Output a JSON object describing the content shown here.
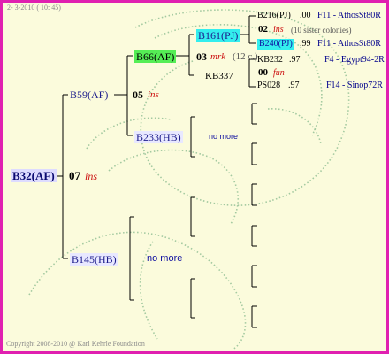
{
  "header": {
    "date": "2-  3-2010 ( 10: 45)"
  },
  "footer": {
    "copyright": "Copyright 2008-2010 @ Karl Kehrle Foundation"
  },
  "colors": {
    "border": "#e020b0",
    "background": "#fbfbdc",
    "line": "#000000",
    "root_box": "#dddbff",
    "pale_box": "#e8e8ff",
    "green_box": "#55ee55",
    "cyan_box": "#33eeee",
    "watermark": "#9ac49a"
  },
  "pedigree": {
    "root": {
      "label": "B32(AF)",
      "num": "07",
      "tag": "ins"
    },
    "sire": {
      "label": "B59(AF)",
      "num": "05",
      "tag": "ins"
    },
    "dam": {
      "label": "B145(HB)",
      "note": "no more"
    },
    "sire_sire": {
      "label": "B66(AF)",
      "num": "03",
      "tag": "mrk",
      "extra": "(12 c.)"
    },
    "sire_dam": {
      "label": "B233(HB)",
      "note": "no more"
    },
    "sss": {
      "label": "B161(PJ)"
    },
    "ssd": {
      "label": "KB337"
    },
    "g4": [
      {
        "label": "B216(PJ)",
        "value": ".00",
        "info": "F11 - AthosSt80R"
      },
      {
        "num": "02",
        "tag": "ins",
        "extra": "(10 sister colonies)"
      },
      {
        "label": "B240(PJ)",
        "value": ".99",
        "info": "F11 - AthosSt80R"
      },
      {
        "label": "KB232",
        "value": ".97",
        "info": "F4 - Egypt94-2R"
      },
      {
        "num": "00",
        "tag": "fun"
      },
      {
        "label": "PS028",
        "value": ".97",
        "info": "F14 - Sinop72R"
      }
    ]
  }
}
